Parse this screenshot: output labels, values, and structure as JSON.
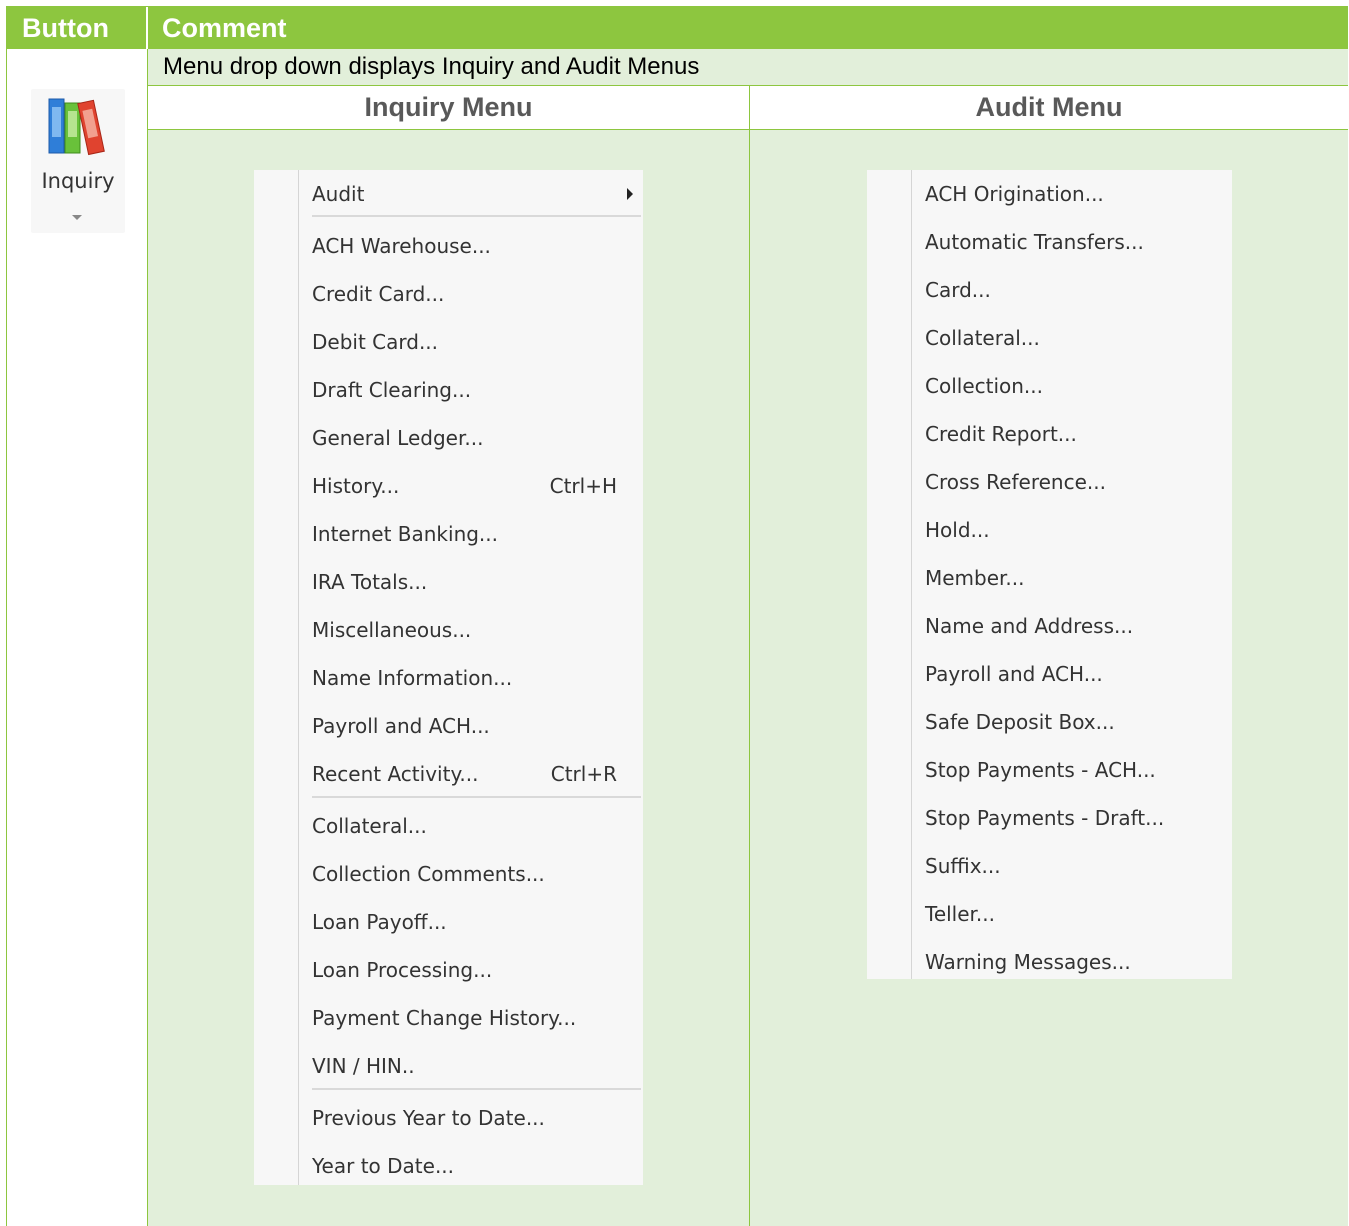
{
  "table": {
    "header_button": "Button",
    "header_comment": "Comment",
    "intro": "Menu drop down displays Inquiry and Audit Menus",
    "inquiry_heading": "Inquiry Menu",
    "audit_heading": "Audit Menu"
  },
  "ribbon_button": {
    "label": "Inquiry",
    "icon": "books-icon"
  },
  "inquiry_menu": {
    "items": [
      "Audit",
      "ACH Warehouse...",
      "Credit Card...",
      "Debit Card...",
      "Draft Clearing...",
      "General Ledger...",
      "History...",
      "Internet Banking...",
      "IRA Totals...",
      "Miscellaneous...",
      "Name Information...",
      "Payroll and ACH...",
      "Recent Activity...",
      "Collateral...",
      "Collection Comments...",
      "Loan Payoff...",
      "Loan Processing...",
      "Payment Change History...",
      "VIN / HIN..",
      "Previous Year to Date...",
      "Year to Date..."
    ],
    "shortcuts": {
      "history": "Ctrl+H",
      "recent_activity": "Ctrl+R"
    }
  },
  "audit_menu": {
    "items": [
      "ACH Origination...",
      "Automatic Transfers...",
      "Card...",
      "Collateral...",
      "Collection...",
      "Credit Report...",
      "Cross Reference...",
      "Hold...",
      "Member...",
      "Name and Address...",
      "Payroll and ACH...",
      "Safe Deposit Box...",
      "Stop Payments - ACH...",
      "Stop Payments - Draft...",
      "Suffix...",
      "Teller...",
      "Warning Messages..."
    ]
  },
  "colors": {
    "header_green": "#8dc63f",
    "row_light_green": "#e2efda",
    "menu_bg": "#f7f7f7"
  }
}
